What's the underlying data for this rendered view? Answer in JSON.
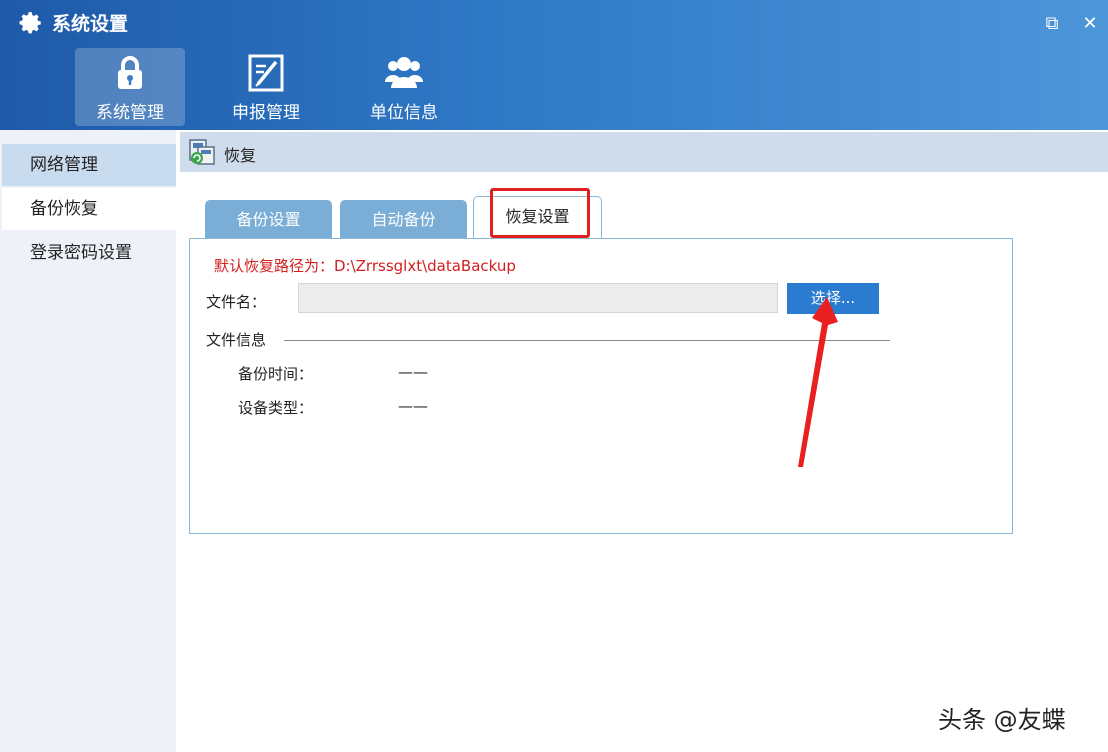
{
  "window": {
    "title": "系统设置",
    "restore_glyph": "⧉",
    "close_glyph": "✕"
  },
  "main_tabs": [
    {
      "label": "系统管理",
      "icon": "lock-icon",
      "active": true
    },
    {
      "label": "申报管理",
      "icon": "edit-document-icon",
      "active": false
    },
    {
      "label": "单位信息",
      "icon": "users-icon",
      "active": false
    }
  ],
  "sidebar": {
    "items": [
      {
        "label": "网络管理"
      },
      {
        "label": "备份恢复"
      },
      {
        "label": "登录密码设置"
      }
    ]
  },
  "breadcrumb": {
    "label": "恢复",
    "icon": "restore-icon"
  },
  "tabs": [
    {
      "label": "备份设置"
    },
    {
      "label": "自动备份"
    },
    {
      "label": "恢复设置"
    }
  ],
  "restore": {
    "default_path": "默认恢复路径为：D:\\Zrrssglxt\\dataBackup",
    "filename_label": "文件名：",
    "filename_value": "",
    "choose_label": "选择...",
    "info_title": "文件信息",
    "backup_time_label": "备份时间：",
    "backup_time_value": "——",
    "device_type_label": "设备类型：",
    "device_type_value": "——"
  },
  "colors": {
    "header_start": "#1e5aa8",
    "header_end": "#4d96da",
    "tab_inactive": "#7aaed6",
    "path_red": "#d31f1f",
    "button_blue": "#2b7cd1",
    "annotation_red": "#e02020"
  },
  "watermark": "头条 @友蝶"
}
